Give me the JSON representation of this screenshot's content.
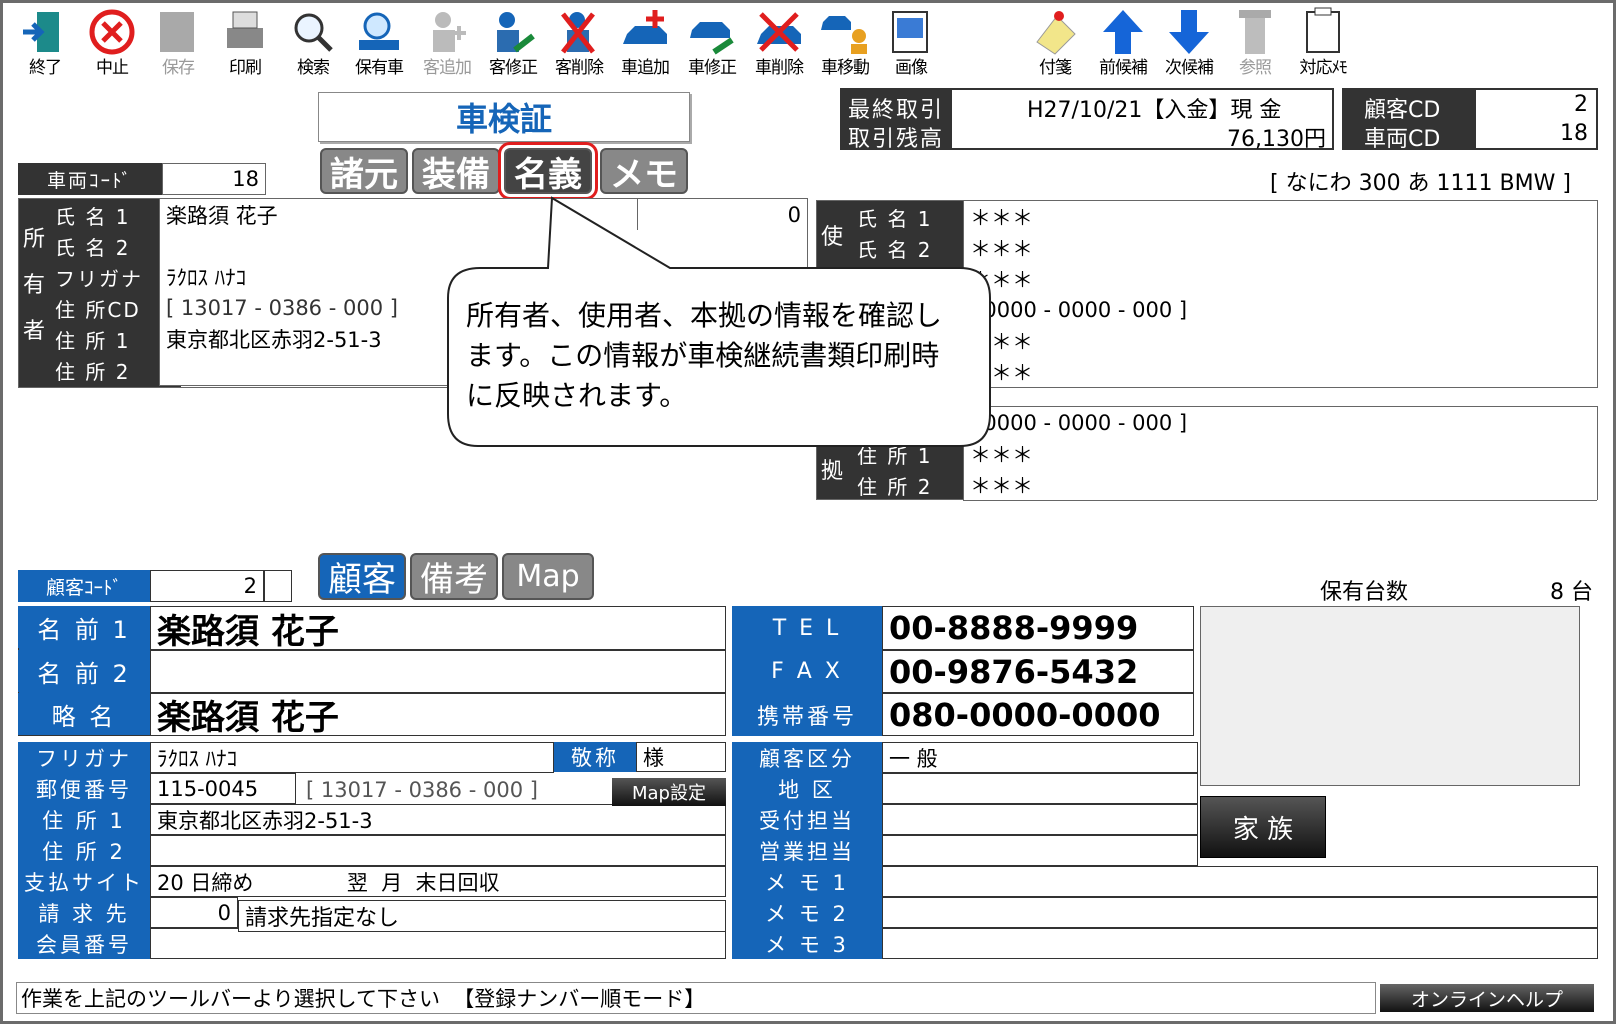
{
  "toolbar": {
    "items": [
      {
        "label": "終了",
        "icon": "exit-door-icon",
        "enabled": true
      },
      {
        "label": "中止",
        "icon": "cancel-circle-icon",
        "enabled": true
      },
      {
        "label": "保存",
        "icon": "save-icon",
        "enabled": false
      },
      {
        "label": "印刷",
        "icon": "printer-icon",
        "enabled": true
      },
      {
        "label": "検索",
        "icon": "magnifier-icon",
        "enabled": true
      },
      {
        "label": "保有車",
        "icon": "car-search-icon",
        "enabled": true
      },
      {
        "label": "客追加",
        "icon": "customer-add-icon",
        "enabled": false
      },
      {
        "label": "客修正",
        "icon": "customer-edit-icon",
        "enabled": true
      },
      {
        "label": "客削除",
        "icon": "customer-delete-icon",
        "enabled": true
      },
      {
        "label": "車追加",
        "icon": "car-add-icon",
        "enabled": true
      },
      {
        "label": "車修正",
        "icon": "car-edit-icon",
        "enabled": true
      },
      {
        "label": "車削除",
        "icon": "car-delete-icon",
        "enabled": true
      },
      {
        "label": "車移動",
        "icon": "car-move-icon",
        "enabled": true
      },
      {
        "label": "画像",
        "icon": "image-icon",
        "enabled": true
      },
      {
        "label": "付箋",
        "icon": "sticky-note-icon",
        "enabled": true
      },
      {
        "label": "前候補",
        "icon": "arrow-up-icon",
        "enabled": true
      },
      {
        "label": "次候補",
        "icon": "arrow-down-icon",
        "enabled": true
      },
      {
        "label": "参照",
        "icon": "reference-icon",
        "enabled": false
      },
      {
        "label": "対応ﾒﾓ",
        "icon": "memo-icon",
        "enabled": true
      }
    ]
  },
  "header": {
    "title": "車検証",
    "last_trade_label": "最終取引",
    "last_trade_value": "H27/10/21【入金】現  金",
    "balance_label": "取引残高",
    "balance_value": "76,130円",
    "customer_cd_label": "顧客CD",
    "customer_cd_value": "2",
    "vehicle_cd_label": "車両CD",
    "vehicle_cd_value": "18",
    "vehicle_code_label": "車両ｺｰﾄﾞ",
    "vehicle_code_value": "18",
    "plate": "[ なにわ 300 あ 1111 BMW  ]"
  },
  "tabs": [
    "諸元",
    "装備",
    "名義",
    "メモ"
  ],
  "owner": {
    "side_label": [
      "所",
      "有",
      "者"
    ],
    "rows": [
      {
        "label": "氏 名 1",
        "value": "楽路須  花子",
        "extra": "0"
      },
      {
        "label": "氏 名 2",
        "value": ""
      },
      {
        "label": "フリガナ",
        "value": "ﾗｸﾛｽ ﾊﾅｺ"
      },
      {
        "label": "住 所CD",
        "value": "[  13017  -  0386  -  000  ]"
      },
      {
        "label": "住 所 1",
        "value": "東京都北区赤羽2-51-3"
      },
      {
        "label": "住 所 2",
        "value": ""
      }
    ]
  },
  "user": {
    "side_label": "使",
    "rows": [
      {
        "label": "氏 名 1",
        "value": "＊＊＊"
      },
      {
        "label": "氏 名 2",
        "value": "＊＊＊"
      },
      {
        "label": "",
        "value": "＊＊＊"
      },
      {
        "label": "",
        "value": "00000  -  0000  -  000  ]"
      },
      {
        "label": "",
        "value": "＊＊＊"
      },
      {
        "label": "",
        "value": "＊＊＊"
      }
    ]
  },
  "base": {
    "side_label": "拠",
    "rows": [
      {
        "label": "",
        "value": "00000  -  0000  -  000  ]"
      },
      {
        "label": "住 所 1",
        "value": "＊＊＊"
      },
      {
        "label": "住 所 2",
        "value": "＊＊＊"
      }
    ]
  },
  "callout": "所有者、使用者、本拠の情報を確認します。この情報が車検継続書類印刷時に反映されます。",
  "customer": {
    "code_label": "顧客ｺｰﾄﾞ",
    "code_value": "2",
    "tabs": [
      "顧客",
      "備考",
      "Map"
    ],
    "vehicle_count_label": "保有台数",
    "vehicle_count_value": "8 台",
    "name1_label": "名 前 1",
    "name1_value": "楽路須  花子",
    "name2_label": "名 前 2",
    "name2_value": "",
    "short_label": "略  名",
    "short_value": "楽路須  花子",
    "tel_label": "T E L",
    "tel_value": "00-8888-9999",
    "fax_label": "F A X",
    "fax_value": "00-9876-5432",
    "mobile_label": "携帯番号",
    "mobile_value": "080-0000-0000",
    "kana_label": "フリガナ",
    "kana_value": "ﾗｸﾛｽ ﾊﾅｺ",
    "honorific_label": "敬称",
    "honorific_value": "様",
    "zip_label": "郵便番号",
    "zip_value": "115-0045",
    "zip_code": "[   13017  -  0386  -  000   ]",
    "map_button": "Map設定",
    "addr1_label": "住 所 1",
    "addr1_value": "東京都北区赤羽2-51-3",
    "addr2_label": "住 所 2",
    "addr2_value": "",
    "pay_label": "支払サイト",
    "pay_value": "20 日締め              翌  月  末日回収",
    "bill_label": "請 求 先",
    "bill_num": "0",
    "bill_value": "請求先指定なし",
    "member_label": "会員番号",
    "member_value": "",
    "class_label": "顧客区分",
    "class_value": "一  般",
    "area_label": "地    区",
    "area_value": "",
    "reception_label": "受付担当",
    "reception_value": "",
    "sales_label": "営業担当",
    "sales_value": "",
    "memo1_label": "メ モ 1",
    "memo2_label": "メ モ 2",
    "memo3_label": "メ モ 3",
    "family_button": "家 族"
  },
  "status": {
    "message": "作業を上記のツールバーより選択して下さい  【登録ナンバー順モード】",
    "help_button": "オンラインヘルプ"
  }
}
